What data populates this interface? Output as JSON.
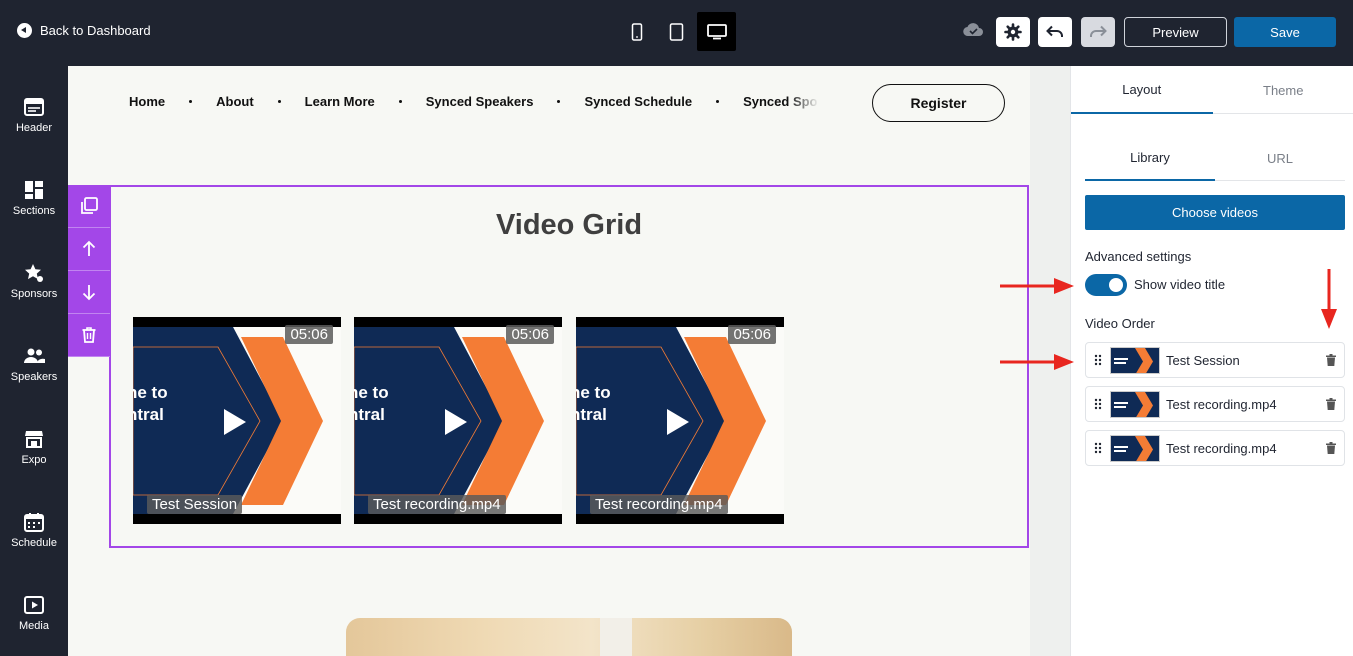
{
  "topbar": {
    "back_label": "Back to Dashboard",
    "devices": [
      "mobile-icon",
      "tablet-icon",
      "desktop-icon"
    ],
    "active_device": "desktop",
    "preview_label": "Preview",
    "save_label": "Save"
  },
  "leftbar": {
    "items": [
      {
        "label": "Header",
        "icon": "header-icon"
      },
      {
        "label": "Sections",
        "icon": "sections-icon"
      },
      {
        "label": "Sponsors",
        "icon": "sponsors-icon"
      },
      {
        "label": "Speakers",
        "icon": "speakers-icon"
      },
      {
        "label": "Expo",
        "icon": "expo-icon"
      },
      {
        "label": "Schedule",
        "icon": "schedule-icon"
      },
      {
        "label": "Media",
        "icon": "media-icon"
      }
    ]
  },
  "canvas": {
    "nav": [
      "Home",
      "About",
      "Learn More",
      "Synced Speakers",
      "Synced Schedule",
      "Synced Spo"
    ],
    "register_label": "Register",
    "block_title": "Video Grid",
    "videos": [
      {
        "title": "Test Session",
        "duration": "05:06",
        "overlay_text": "ne to\nntral"
      },
      {
        "title": "Test recording.mp4",
        "duration": "05:06",
        "overlay_text": "ne to\nntral"
      },
      {
        "title": "Test recording.mp4",
        "duration": "05:06",
        "overlay_text": "ne to\nntral"
      }
    ]
  },
  "panel": {
    "tabs": [
      "Layout",
      "Theme"
    ],
    "active_tab": "Layout",
    "subtabs": [
      "Library",
      "URL"
    ],
    "active_subtab": "Library",
    "choose_label": "Choose videos",
    "advanced_label": "Advanced settings",
    "show_title_label": "Show video title",
    "show_title_on": true,
    "order_label": "Video Order",
    "order": [
      "Test Session",
      "Test recording.mp4",
      "Test recording.mp4"
    ]
  },
  "colors": {
    "dark": "#1f2430",
    "primary": "#0b67a6",
    "selection": "#a347e8",
    "arrow": "#e8261f",
    "video_navy": "#0f2a55",
    "video_orange": "#f47c35"
  }
}
